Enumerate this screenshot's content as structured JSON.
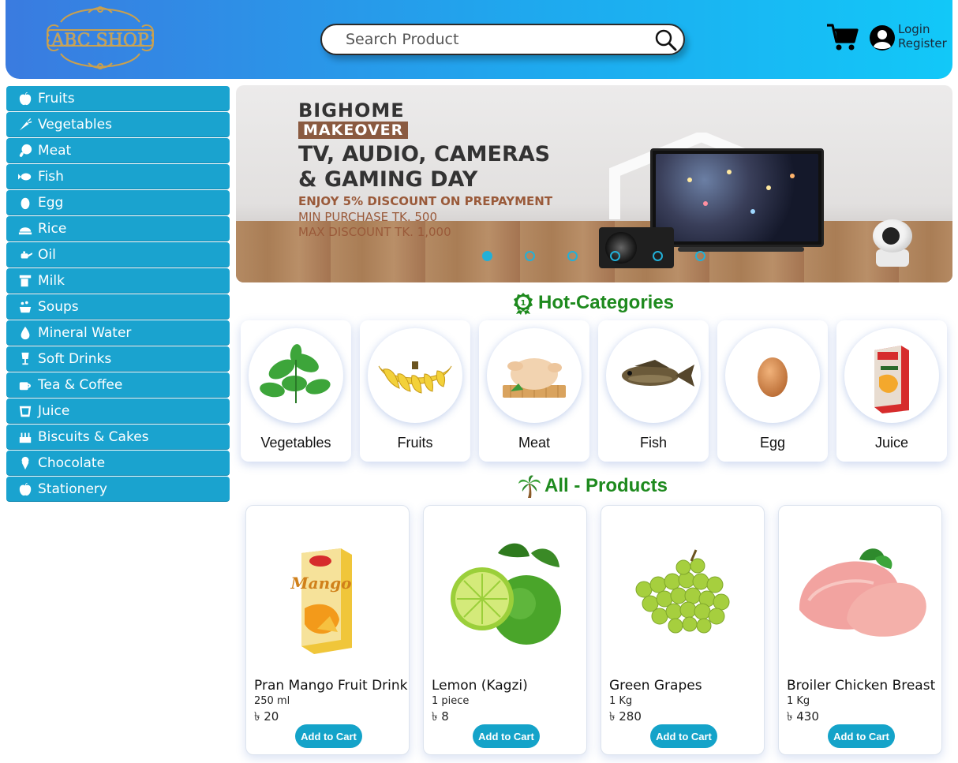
{
  "header": {
    "logo_text": "ABC SHOP",
    "search_placeholder": "Search Product",
    "login_label": "Login",
    "register_label": "Register"
  },
  "sidebar": {
    "items": [
      {
        "label": "Fruits",
        "icon": "apple-icon"
      },
      {
        "label": "Vegetables",
        "icon": "carrot-icon"
      },
      {
        "label": "Meat",
        "icon": "drumstick-icon"
      },
      {
        "label": "Fish",
        "icon": "fish-icon"
      },
      {
        "label": "Egg",
        "icon": "egg-icon"
      },
      {
        "label": "Rice",
        "icon": "rice-bowl-icon"
      },
      {
        "label": "Oil",
        "icon": "oil-can-icon"
      },
      {
        "label": "Milk",
        "icon": "milk-icon"
      },
      {
        "label": "Soups",
        "icon": "soup-pot-icon"
      },
      {
        "label": "Mineral Water",
        "icon": "water-drop-icon"
      },
      {
        "label": "Soft Drinks",
        "icon": "glass-icon"
      },
      {
        "label": "Tea & Coffee",
        "icon": "coffee-cup-icon"
      },
      {
        "label": "Juice",
        "icon": "juice-glass-icon"
      },
      {
        "label": "Biscuits & Cakes",
        "icon": "cake-icon"
      },
      {
        "label": "Chocolate",
        "icon": "ice-cream-icon"
      },
      {
        "label": "Stationery",
        "icon": "apple-icon"
      }
    ]
  },
  "banner": {
    "brand_top": "BIGHOME",
    "brand_bottom": "MAKEOVER",
    "title_line1": "TV, AUDIO, CAMERAS",
    "title_line2": "& GAMING DAY",
    "discount": "ENJOY 5% DISCOUNT ON PREPAYMENT",
    "min_purchase": "MIN PURCHASE TK. 500",
    "max_discount": "MAX DISCOUNT TK. 1,000",
    "slide_count": 6,
    "active_slide": 1
  },
  "hot_categories": {
    "title": "Hot-Categories",
    "items": [
      {
        "label": "Vegetables"
      },
      {
        "label": "Fruits"
      },
      {
        "label": "Meat"
      },
      {
        "label": "Fish"
      },
      {
        "label": "Egg"
      },
      {
        "label": "Juice"
      }
    ]
  },
  "all_products": {
    "title": "All - Products",
    "items": [
      {
        "name": "Pran Mango Fruit Drink",
        "unit": "250 ml",
        "price": "৳ 20",
        "button": "Add to Cart"
      },
      {
        "name": "Lemon (Kagzi)",
        "unit": "1 piece",
        "price": "৳ 8",
        "button": "Add to Cart"
      },
      {
        "name": "Green Grapes",
        "unit": "1 Kg",
        "price": "৳ 280",
        "button": "Add to Cart"
      },
      {
        "name": "Broiler Chicken Breast",
        "unit": "1 Kg",
        "price": "৳ 430",
        "button": "Add to Cart"
      }
    ]
  },
  "colors": {
    "header_gradient_start": "#3a7be0",
    "header_gradient_end": "#12c8f8",
    "sidebar_bg": "#1aa3cf",
    "section_title": "#1e8a1e",
    "button_bg": "#14a3c9"
  }
}
